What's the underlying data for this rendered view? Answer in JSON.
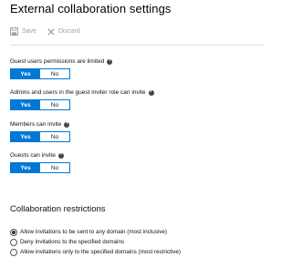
{
  "page": {
    "title": "External collaboration settings"
  },
  "toolbar": {
    "save_label": "Save",
    "discard_label": "Discard"
  },
  "settings": [
    {
      "label": "Guest users permissions are limited",
      "yes": "Yes",
      "no": "No",
      "selected": "Yes"
    },
    {
      "label": "Admins and users in the guest inviter role can invite",
      "yes": "Yes",
      "no": "No",
      "selected": "Yes"
    },
    {
      "label": "Members can invite",
      "yes": "Yes",
      "no": "No",
      "selected": "Yes"
    },
    {
      "label": "Guests can invite",
      "yes": "Yes",
      "no": "No",
      "selected": "Yes"
    }
  ],
  "collaboration": {
    "title": "Collaboration restrictions",
    "options": [
      {
        "label": "Allow invitations to be sent to any domain (most inclusive)",
        "checked": true
      },
      {
        "label": "Deny invitations to the specified domains",
        "checked": false
      },
      {
        "label": "Allow invitations only to the specified domains (most restrictive)",
        "checked": false
      }
    ]
  },
  "colors": {
    "accent": "#0078d4",
    "disabled_text": "#a0a0a0"
  },
  "icons": {
    "save": "save-icon",
    "discard": "discard-icon",
    "info": "info-icon"
  }
}
